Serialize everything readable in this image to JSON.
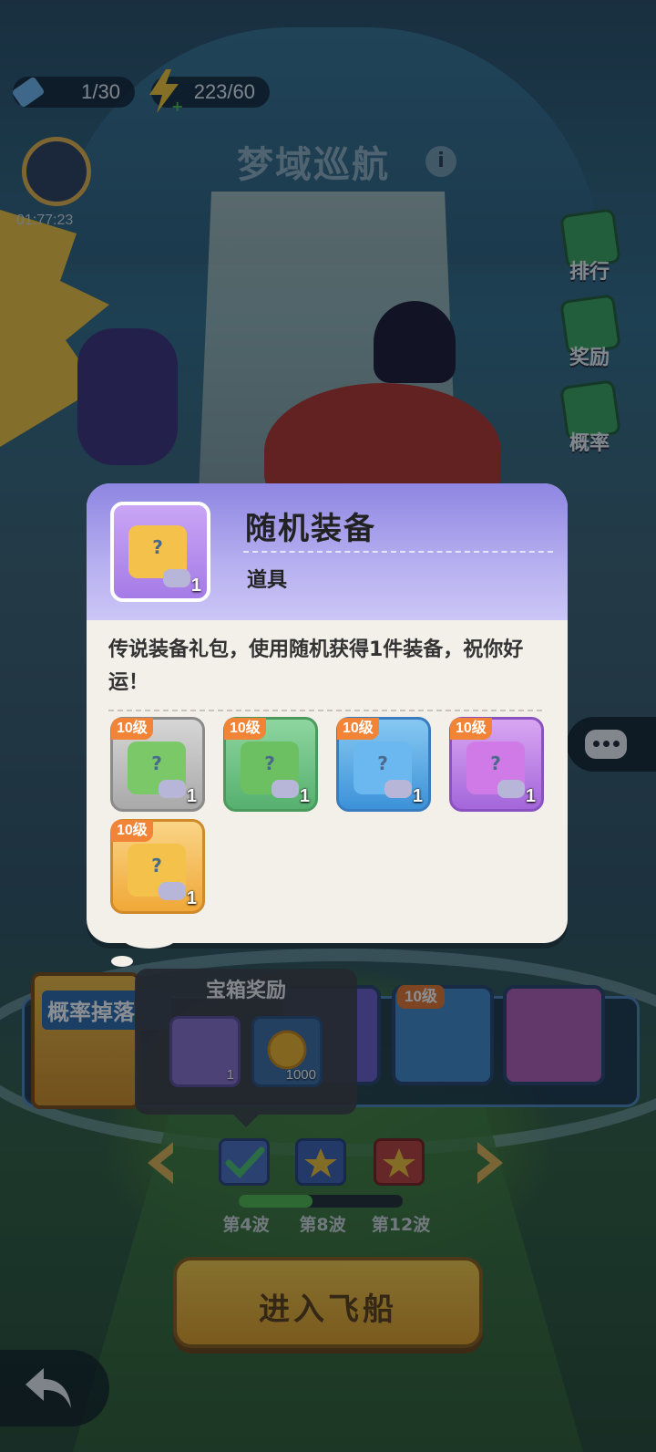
{
  "hud": {
    "tickets": "1/30",
    "energy": "223/60",
    "timer": "01:77:23",
    "title": "梦域巡航",
    "info_icon": "i"
  },
  "side_menu": [
    {
      "label": "排行",
      "icon": "magnifier-icon"
    },
    {
      "label": "奖励",
      "icon": "gift-icon"
    },
    {
      "label": "概率",
      "icon": "question-icon"
    }
  ],
  "popup": {
    "name": "随机装备",
    "type": "道具",
    "quantity": "1",
    "description": "传说装备礼包，使用随机获得1件装备，祝你好运！",
    "items": [
      {
        "level": "10级",
        "qty": "1",
        "rarity": "gray"
      },
      {
        "level": "10级",
        "qty": "1",
        "rarity": "green"
      },
      {
        "level": "10级",
        "qty": "1",
        "rarity": "blue"
      },
      {
        "level": "10级",
        "qty": "1",
        "rarity": "purple"
      },
      {
        "level": "10级",
        "qty": "1",
        "rarity": "orange"
      }
    ]
  },
  "bottom": {
    "drop_banner": "概率掉落",
    "strip_badge": "10级",
    "tooltip": {
      "title": "宝箱奖励",
      "items": [
        {
          "qty": "1",
          "icon": "equipment-box-icon"
        },
        {
          "qty": "1000",
          "icon": "gold-coin-icon"
        }
      ]
    },
    "waves": [
      "第4波",
      "第8波",
      "第12波"
    ],
    "wave_progress": 0.45,
    "enter_button": "进入飞船"
  },
  "colors": {
    "popup_header": "#8e86e2",
    "level_badge": "#f18436",
    "enter_button": "#f5c842"
  }
}
